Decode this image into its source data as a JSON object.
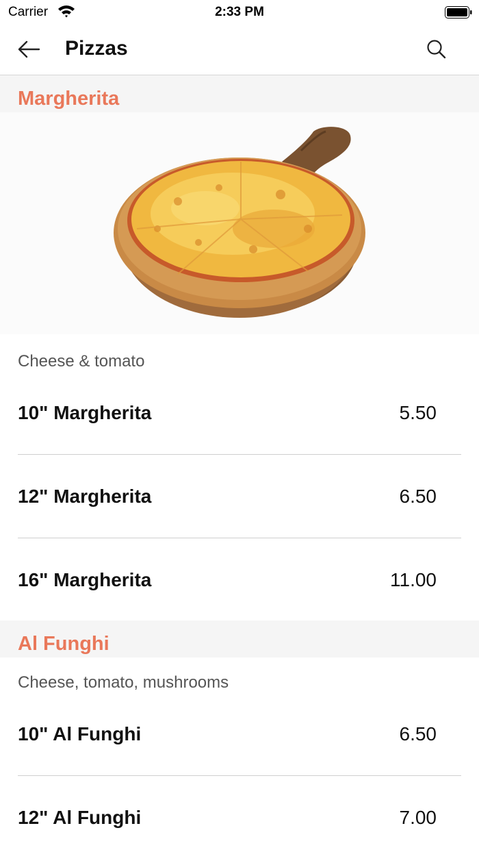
{
  "status_bar": {
    "carrier": "Carrier",
    "time": "2:33 PM"
  },
  "nav": {
    "title": "Pizzas",
    "back_icon": "arrow-left-icon",
    "search_icon": "search-icon"
  },
  "sections": [
    {
      "title": "Margherita",
      "description": "Cheese & tomato",
      "items": [
        {
          "name": "10\" Margherita",
          "price": "5.50"
        },
        {
          "name": "12\" Margherita",
          "price": "6.50"
        },
        {
          "name": "16\" Margherita",
          "price": "11.00"
        }
      ]
    },
    {
      "title": "Al Funghi",
      "description": "Cheese, tomato, mushrooms",
      "items": [
        {
          "name": "10\" Al Funghi",
          "price": "6.50"
        },
        {
          "name": "12\" Al Funghi",
          "price": "7.00"
        }
      ]
    }
  ],
  "colors": {
    "accent": "#e9785a",
    "section_bg": "#f5f5f5",
    "divider": "#cfcfcf"
  }
}
